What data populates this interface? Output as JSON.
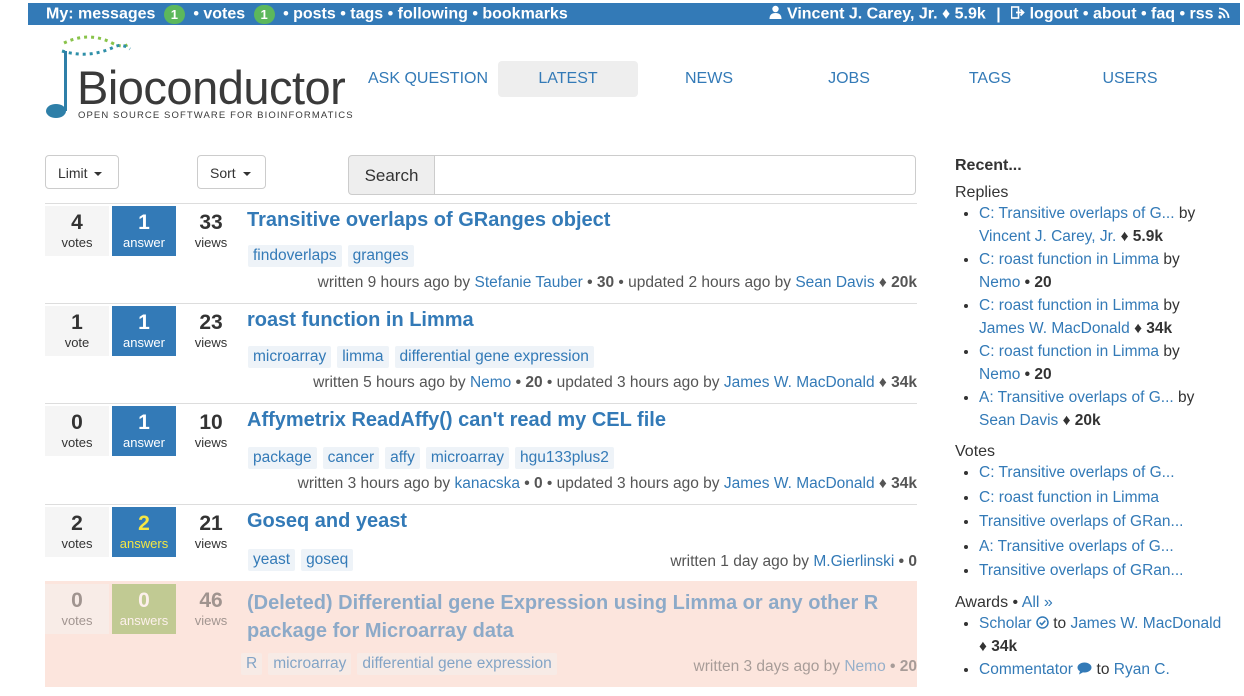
{
  "topbar": {
    "my": "My:",
    "messages": "messages",
    "messages_count": "1",
    "votes": "• votes",
    "votes_count": "1",
    "links": "• posts • tags • following • bookmarks",
    "user": "Vincent J. Carey, Jr.",
    "user_rep": "♦ 5.9k",
    "sep": "|",
    "logout": "logout",
    "about": "• about",
    "faq": "• faq",
    "rss": "• rss"
  },
  "header": {
    "logo_word": "Bioconductor",
    "logo_tagline": "OPEN SOURCE SOFTWARE FOR BIOINFORMATICS",
    "nav": [
      "ASK QUESTION",
      "LATEST",
      "NEWS",
      "JOBS",
      "TAGS",
      "USERS"
    ]
  },
  "controls": {
    "limit": "Limit",
    "sort": "Sort",
    "search_label": "Search",
    "search_value": ""
  },
  "posts": [
    {
      "votes": "4",
      "votes_label": "votes",
      "answers": "1",
      "answers_label": "answer",
      "views": "33",
      "views_label": "views",
      "title": "Transitive overlaps of GRanges object",
      "tags": [
        "findoverlaps",
        "granges"
      ],
      "meta_pre": "written 9 hours ago by",
      "author": "Stefanie Tauber",
      "author_rep": "• 30",
      "meta_mid": "• updated 2 hours ago by",
      "updater": "Sean Davis",
      "updater_rep": "♦ 20k"
    },
    {
      "votes": "1",
      "votes_label": "vote",
      "answers": "1",
      "answers_label": "answer",
      "views": "23",
      "views_label": "views",
      "title": "roast function in Limma",
      "tags": [
        "microarray",
        "limma",
        "differential gene expression"
      ],
      "meta_pre": "written 5 hours ago by",
      "author": "Nemo",
      "author_rep": "• 20",
      "meta_mid": "• updated 3 hours ago by",
      "updater": "James W. MacDonald",
      "updater_rep": "♦ 34k"
    },
    {
      "votes": "0",
      "votes_label": "votes",
      "answers": "1",
      "answers_label": "answer",
      "views": "10",
      "views_label": "views",
      "title": "Affymetrix ReadAffy() can't read my CEL file",
      "tags": [
        "package",
        "cancer",
        "affy",
        "microarray",
        "hgu133plus2"
      ],
      "meta_pre": "written 3 hours ago by",
      "author": "kanacska",
      "author_rep": "• 0",
      "meta_mid": "• updated 3 hours ago by",
      "updater": "James W. MacDonald",
      "updater_rep": "♦ 34k"
    },
    {
      "votes": "2",
      "votes_label": "votes",
      "answers": "2",
      "answers_label": "answers",
      "views": "21",
      "views_label": "views",
      "title": "Goseq and yeast",
      "tags": [
        "yeast",
        "goseq"
      ],
      "meta_pre": "written 1 day ago by",
      "author": "M.Gierlinski",
      "author_rep": "• 0"
    },
    {
      "votes": "0",
      "votes_label": "votes",
      "answers": "0",
      "answers_label": "answers",
      "views": "46",
      "views_label": "views",
      "title": "(Deleted) Differential gene Expression using Limma or any other R package for Microarray data",
      "tags": [
        "R",
        "microarray",
        "differential gene expression"
      ],
      "meta_pre": "written 3 days ago by",
      "author": "Nemo",
      "author_rep": "• 20"
    }
  ],
  "sidebar": {
    "recent": "Recent...",
    "replies_heading": "Replies",
    "replies": [
      {
        "link": "C: Transitive overlaps of G...",
        "by": "by",
        "user": "Vincent J. Carey, Jr.",
        "rep": "♦ 5.9k"
      },
      {
        "link": "C: roast function in Limma",
        "by": "by",
        "user": "Nemo",
        "rep": "• 20"
      },
      {
        "link": "C: roast function in Limma",
        "by": "by",
        "user": "James W. MacDonald",
        "rep": "♦ 34k"
      },
      {
        "link": "C: roast function in Limma",
        "by": "by",
        "user": "Nemo",
        "rep": "• 20"
      },
      {
        "link": "A: Transitive overlaps of G...",
        "by": "by",
        "user": "Sean Davis",
        "rep": "♦ 20k"
      }
    ],
    "votes_heading": "Votes",
    "votes": [
      "C: Transitive overlaps of G...",
      "C: roast function in Limma",
      "Transitive overlaps of GRan...",
      "A: Transitive overlaps of G...",
      "Transitive overlaps of GRan..."
    ],
    "awards_heading": "Awards",
    "awards_sep": "•",
    "awards_all": "All »",
    "awards": [
      {
        "badge": "Scholar",
        "to": "to",
        "user": "James W. MacDonald",
        "rep": "♦ 34k"
      },
      {
        "badge": "Commentator",
        "to": "to",
        "user": "Ryan C."
      }
    ]
  }
}
